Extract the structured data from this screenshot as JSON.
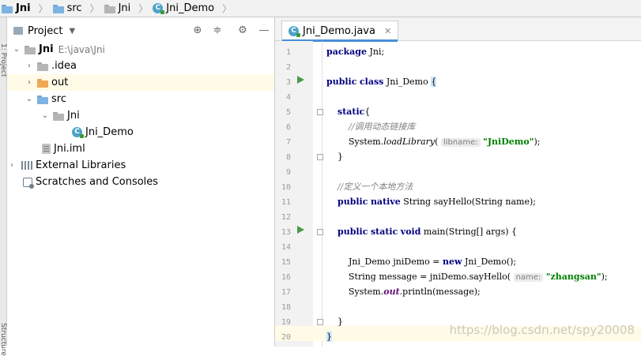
{
  "breadcrumb": {
    "items": [
      {
        "label": "Jni",
        "icon": "module-folder-icon"
      },
      {
        "label": "src",
        "icon": "folder-icon"
      },
      {
        "label": "Jni",
        "icon": "package-folder-icon"
      },
      {
        "label": "Jni_Demo",
        "icon": "java-class-icon"
      }
    ]
  },
  "left_strip": {
    "top_label": "1: Project",
    "bottom_label": "Structure"
  },
  "project_panel": {
    "title": "Project",
    "tree": [
      {
        "label": "Jni",
        "extra": "E:\\java\\Jni"
      },
      {
        "label": ".idea"
      },
      {
        "label": "out"
      },
      {
        "label": "src"
      },
      {
        "label": "Jni"
      },
      {
        "label": "Jni_Demo"
      },
      {
        "label": "Jni.iml"
      },
      {
        "label": "External Libraries"
      },
      {
        "label": "Scratches and Consoles"
      }
    ]
  },
  "editor": {
    "tab_label": "Jni_Demo.java",
    "line_numbers": [
      "1",
      "2",
      "3",
      "4",
      "5",
      "6",
      "7",
      "8",
      "9",
      "10",
      "11",
      "12",
      "13",
      "14",
      "15",
      "16",
      "17",
      "18",
      "19",
      "20"
    ],
    "code": {
      "l1_kw": "package",
      "l1_rest": " Jni;",
      "l3_kw1": "public",
      "l3_kw2": "class",
      "l3_name": " Jni_Demo ",
      "l3_brace": "{",
      "l5_kw": "static",
      "l5_rest": "{",
      "l6_cmt": "//调用动态链接库",
      "l7_a": "System.",
      "l7_fn": "loadLibrary",
      "l7_b": "( ",
      "l7_hint": "libname:",
      "l7_str": "\"JniDemo\"",
      "l7_c": ");",
      "l8": "}",
      "l10_cmt": "//定义一个本地方法",
      "l11_kw1": "public",
      "l11_kw2": "native",
      "l11_rest": " String sayHello(String name);",
      "l13_kw1": "public",
      "l13_kw2": "static",
      "l13_kw3": "void",
      "l13_rest": " main(String[] args) {",
      "l15_a": "Jni_Demo jniDemo = ",
      "l15_kw": "new",
      "l15_b": " Jni_Demo();",
      "l16_a": "String message = jniDemo.sayHello( ",
      "l16_hint": "name:",
      "l16_str": "\"zhangsan\"",
      "l16_b": ");",
      "l17_a": "System.",
      "l17_field": "out",
      "l17_b": ".println(message);",
      "l19": "}",
      "l20": "}"
    },
    "watermark": "https://blog.csdn.net/spy20008"
  },
  "colors": {
    "keyword": "#000080",
    "string": "#008000",
    "comment": "#808080",
    "accent": "#4a8fd8"
  }
}
